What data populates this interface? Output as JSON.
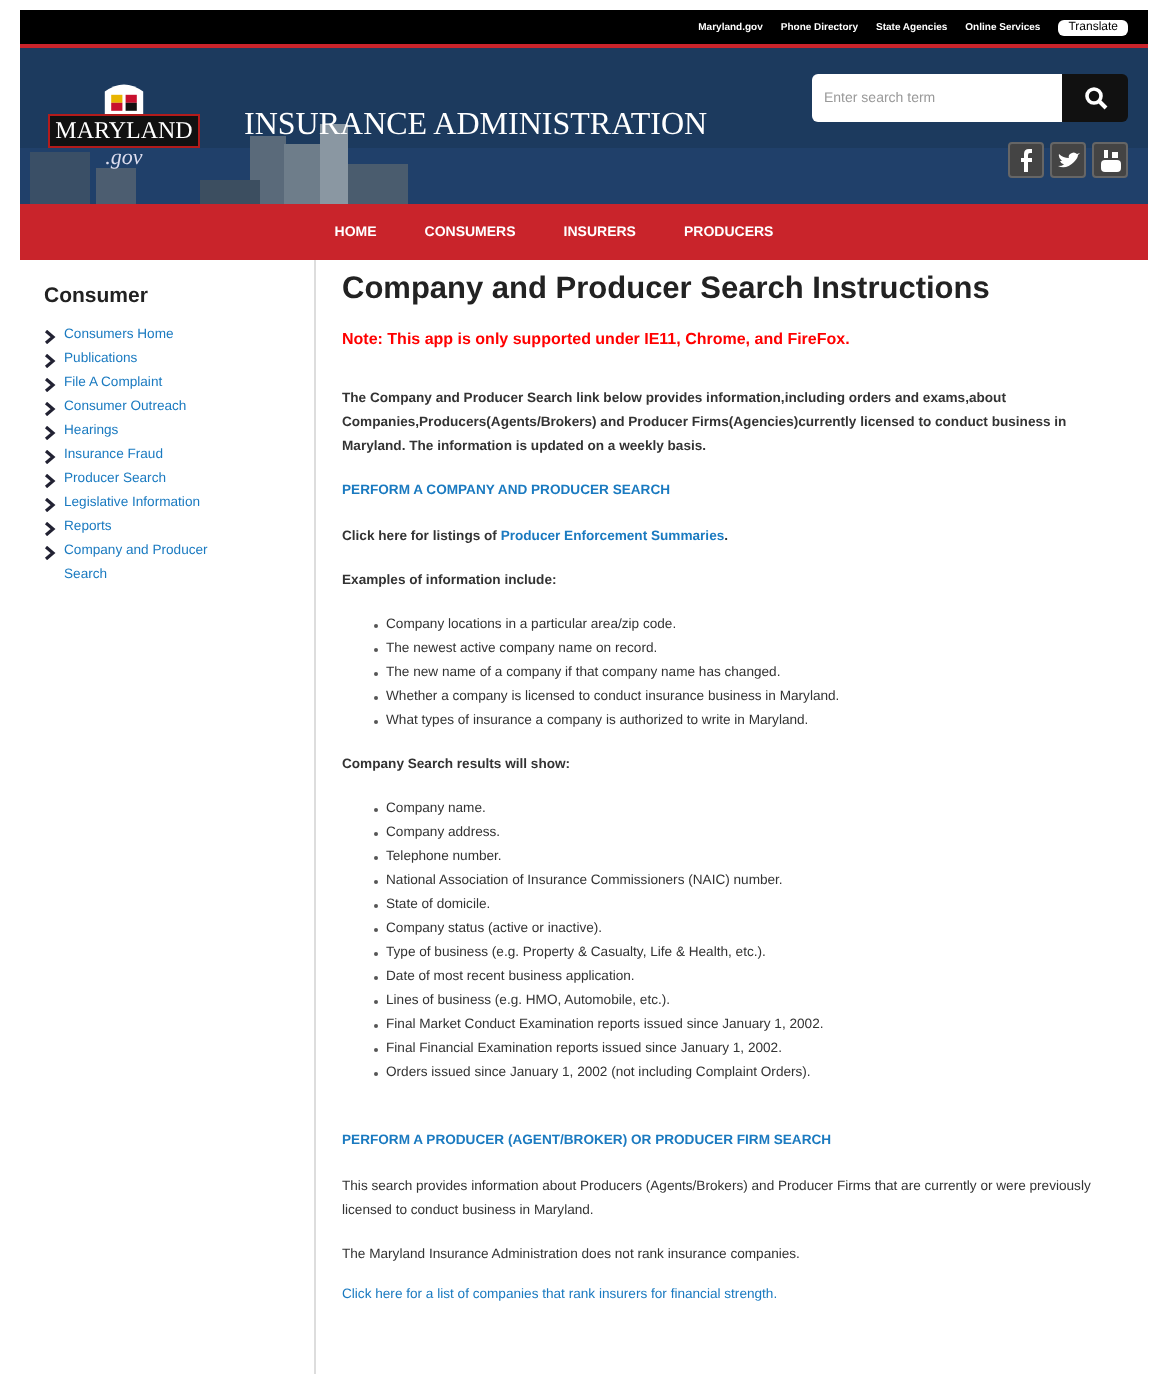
{
  "utility_bar": {
    "links": [
      "Maryland.gov",
      "Phone Directory",
      "State Agencies",
      "Online Services"
    ],
    "translate_button": "Translate"
  },
  "header": {
    "logo": {
      "name": "MARYLAND",
      "suffix": ".gov"
    },
    "site_title": "INSURANCE ADMINISTRATION",
    "search": {
      "placeholder": "Enter search term"
    },
    "social": [
      {
        "kind": "facebook"
      },
      {
        "kind": "twitter"
      },
      {
        "kind": "youtube"
      }
    ]
  },
  "nav": [
    "HOME",
    "CONSUMERS",
    "INSURERS",
    "PRODUCERS"
  ],
  "sidebar": {
    "title": "Consumer",
    "items": [
      "Consumers Home",
      "Publications",
      "File A Complaint",
      "Consumer Outreach",
      "Hearings",
      "Insurance Fraud",
      "Producer Search",
      "Legislative Information",
      "Reports",
      "Company and Producer Search"
    ]
  },
  "content": {
    "title": "Company and Producer Search Instructions",
    "note": "Note: This app is only supported under IE11, Chrome, and FireFox.",
    "intro": "The Company and Producer Search link below provides information,including orders and exams,about Companies,Producers(Agents/Brokers) and Producer Firms(Agencies)currently licensed to conduct business in Maryland. The information is updated on a weekly basis.",
    "company_search_link": "PERFORM A COMPANY AND PRODUCER SEARCH",
    "enforcement": {
      "prefix": "Click here for listings of ",
      "link": "Producer Enforcement Summaries",
      "suffix": "."
    },
    "examples_heading": "Examples of information include:",
    "examples": [
      "Company locations in a particular area/zip code.",
      "The newest active company name on record.",
      "The new name of a company if that company name has changed.",
      "Whether a company is licensed to conduct insurance business in Maryland.",
      "What types of insurance a company is authorized to write in Maryland."
    ],
    "results_heading": "Company Search results will show:",
    "results": [
      "Company name.",
      "Company address.",
      "Telephone number.",
      "National Association of Insurance Commissioners (NAIC) number.",
      "State of domicile.",
      "Company status (active or inactive).",
      "Type of business (e.g. Property & Casualty, Life & Health, etc.).",
      "Date of most recent business application.",
      "Lines of business (e.g. HMO, Automobile, etc.).",
      "Final Market Conduct Examination reports issued since January 1, 2002.",
      "Final Financial Examination reports issued since January 1, 2002.",
      "Orders issued since January 1, 2002 (not including Complaint Orders)."
    ],
    "producer_search_link": "PERFORM A PRODUCER (AGENT/BROKER) OR PRODUCER FIRM SEARCH",
    "producer_text": "This search provides information about Producers (Agents/Brokers) and Producer Firms that are currently or were previously licensed to conduct business in Maryland.",
    "ranking_text": "The Maryland Insurance Administration does not rank insurance companies.",
    "ranking_link": "Click here for a list of companies that rank insurers for financial strength."
  }
}
